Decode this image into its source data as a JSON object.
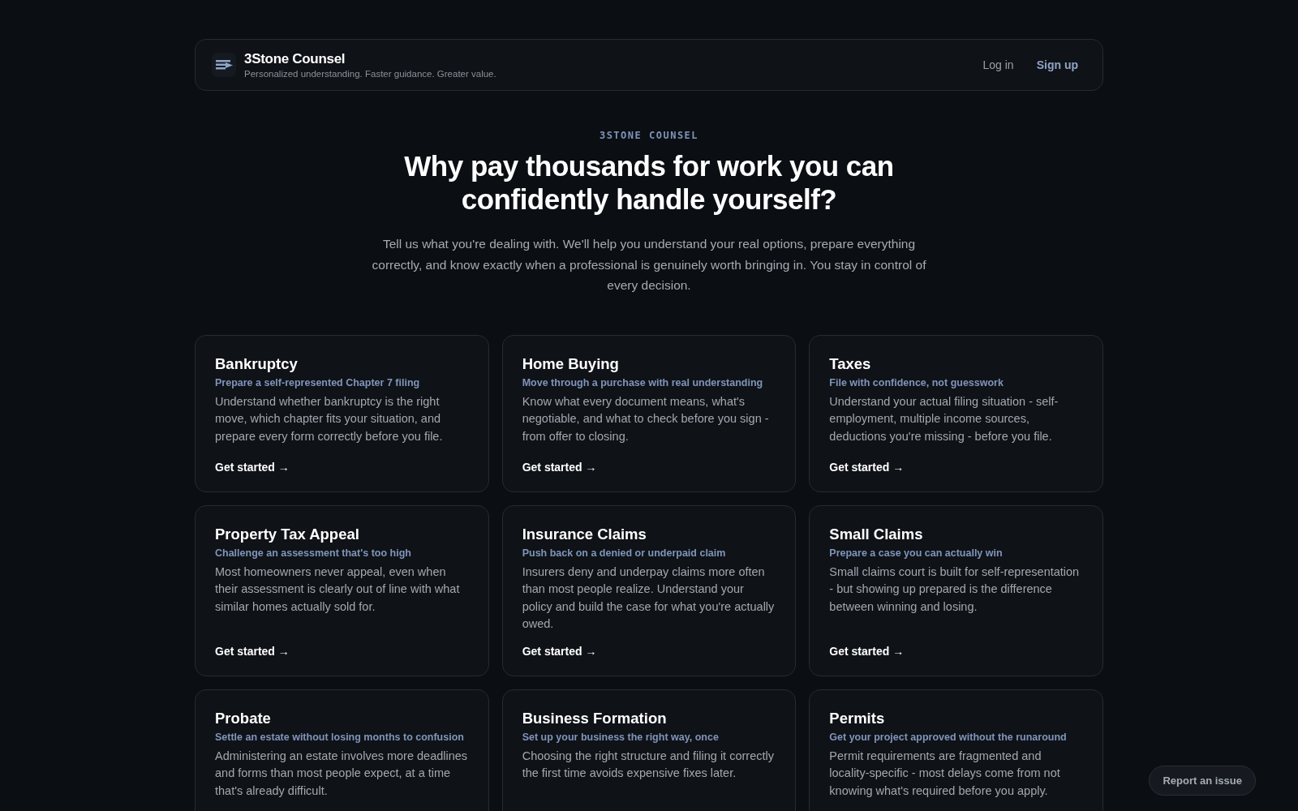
{
  "header": {
    "brand": "3Stone Counsel",
    "tagline": "Personalized understanding. Faster guidance. Greater value.",
    "login": "Log in",
    "signup": "Sign up"
  },
  "hero": {
    "eyebrow": "3STONE COUNSEL",
    "title": "Why pay thousands for work you can confidently handle yourself?",
    "lead": "Tell us what you're dealing with. We'll help you understand your real options, prepare everything correctly, and know exactly when a professional is genuinely worth bringing in. You stay in control of every decision."
  },
  "cards": [
    {
      "title": "Bankruptcy",
      "subtitle": "Prepare a self-represented Chapter 7 filing",
      "description": "Understand whether bankruptcy is the right move, which chapter fits your situation, and prepare every form correctly before you file.",
      "cta": "Get started →"
    },
    {
      "title": "Home Buying",
      "subtitle": "Move through a purchase with real understanding",
      "description": "Know what every document means, what's negotiable, and what to check before you sign - from offer to closing.",
      "cta": "Get started →"
    },
    {
      "title": "Taxes",
      "subtitle": "File with confidence, not guesswork",
      "description": "Understand your actual filing situation - self-employment, multiple income sources, deductions you're missing - before you file.",
      "cta": "Get started →"
    },
    {
      "title": "Property Tax Appeal",
      "subtitle": "Challenge an assessment that's too high",
      "description": "Most homeowners never appeal, even when their assessment is clearly out of line with what similar homes actually sold for.",
      "cta": "Get started →"
    },
    {
      "title": "Insurance Claims",
      "subtitle": "Push back on a denied or underpaid claim",
      "description": "Insurers deny and underpay claims more often than most people realize. Understand your policy and build the case for what you're actually owed.",
      "cta": "Get started →"
    },
    {
      "title": "Small Claims",
      "subtitle": "Prepare a case you can actually win",
      "description": "Small claims court is built for self-representation - but showing up prepared is the difference between winning and losing.",
      "cta": "Get started →"
    },
    {
      "title": "Probate",
      "subtitle": "Settle an estate without losing months to confusion",
      "description": "Administering an estate involves more deadlines and forms than most people expect, at a time that's already difficult."
    },
    {
      "title": "Business Formation",
      "subtitle": "Set up your business the right way, once",
      "description": "Choosing the right structure and filing it correctly the first time avoids expensive fixes later."
    },
    {
      "title": "Permits",
      "subtitle": "Get your project approved without the runaround",
      "description": "Permit requirements are fragmented and locality-specific - most delays come from not knowing what's required before you apply."
    }
  ],
  "report_button": "Report an issue"
}
